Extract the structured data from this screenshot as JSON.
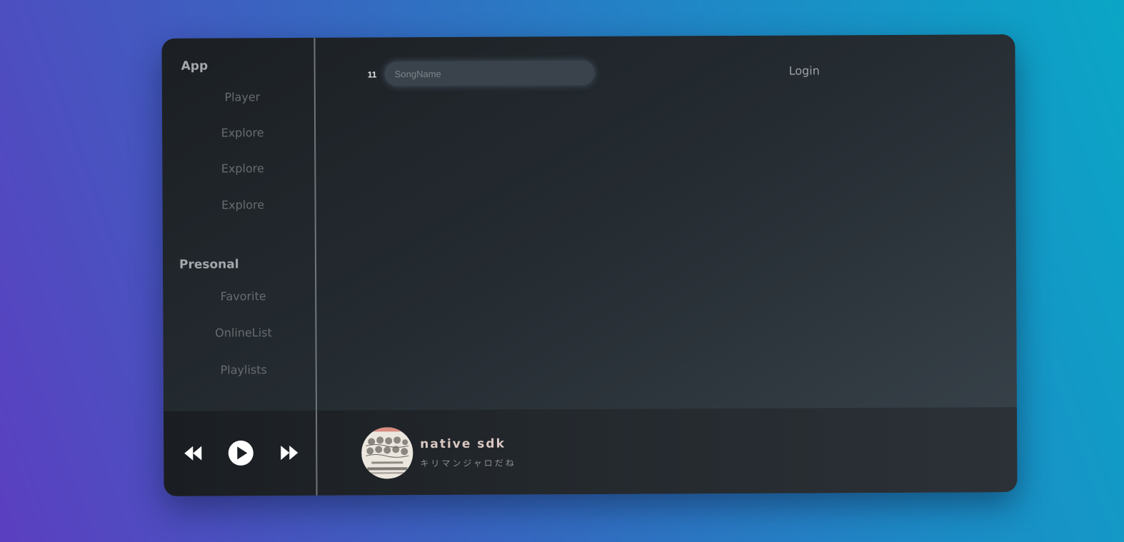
{
  "sidebar": {
    "app_title": "App",
    "app_items": [
      {
        "label": "Player"
      },
      {
        "label": "Explore"
      },
      {
        "label": "Explore"
      },
      {
        "label": "Explore"
      }
    ],
    "personal_title": "Presonal",
    "personal_items": [
      {
        "label": "Favorite"
      },
      {
        "label": "OnlineList"
      },
      {
        "label": "Playlists"
      }
    ]
  },
  "header": {
    "count": "11",
    "search_placeholder": "SongName",
    "search_value": "",
    "login_label": "Login"
  },
  "player": {
    "controls": {
      "prev_icon": "rewind-icon",
      "play_icon": "play-icon",
      "next_icon": "fast-forward-icon"
    },
    "track": {
      "title": "native sdk",
      "artist": "キリマンジャロだね"
    }
  },
  "colors": {
    "window_dark": "#1b1f23",
    "window_light": "#3a444c",
    "muted_text": "#686c70",
    "track_title": "#d9c8c2",
    "background_left": "#5b3fc0",
    "background_right": "#0aa6c6"
  }
}
